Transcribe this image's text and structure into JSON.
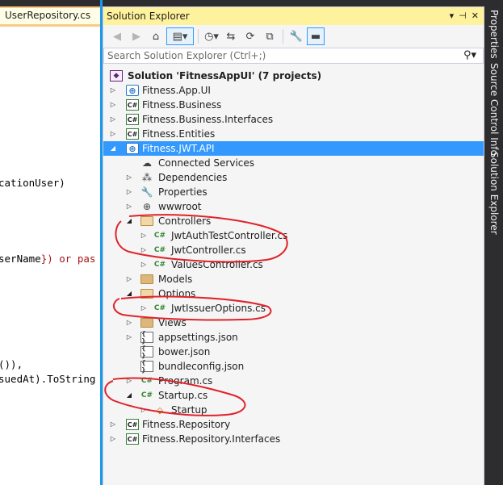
{
  "editor": {
    "tab_label": "UserRepository.cs",
    "code_lines": [
      {
        "pre": "cationUser)",
        "kw": "",
        "post": ""
      },
      {
        "pre": "serName",
        "kw": "",
        "post": "}) or pas"
      },
      {
        "pre": "()),",
        "kw": "",
        "post": ""
      },
      {
        "pre": "suedAt).ToString",
        "kw": "",
        "post": ""
      }
    ]
  },
  "panel": {
    "title": "Solution Explorer",
    "title_buttons": [
      "▾",
      "⊣",
      "✕"
    ],
    "search_placeholder": "Search Solution Explorer (Ctrl+;)",
    "search_glyph": "⚲▾"
  },
  "tree": {
    "solution": "Solution 'FitnessAppUI' (7 projects)",
    "items": [
      {
        "label": "Fitness.App.UI",
        "icon": "web-project-icon"
      },
      {
        "label": "Fitness.Business",
        "icon": "csharp-project-icon"
      },
      {
        "label": "Fitness.Business.Interfaces",
        "icon": "csharp-project-icon"
      },
      {
        "label": "Fitness.Entities",
        "icon": "csharp-project-icon"
      },
      {
        "label": "Fitness.JWT.API",
        "icon": "web-project-icon"
      },
      {
        "label": "Connected Services",
        "icon": "connected-services-icon"
      },
      {
        "label": "Dependencies",
        "icon": "dependencies-icon"
      },
      {
        "label": "Properties",
        "icon": "wrench-icon"
      },
      {
        "label": "wwwroot",
        "icon": "globe-icon"
      },
      {
        "label": "Controllers",
        "icon": "folder-open-icon"
      },
      {
        "label": "JwtAuthTestController.cs",
        "icon": "csharp-file-icon"
      },
      {
        "label": "JwtController.cs",
        "icon": "csharp-file-icon"
      },
      {
        "label": "ValuesController.cs",
        "icon": "csharp-file-icon"
      },
      {
        "label": "Models",
        "icon": "folder-icon"
      },
      {
        "label": "Options",
        "icon": "folder-open-icon"
      },
      {
        "label": "JwtIssuerOptions.cs",
        "icon": "csharp-file-icon"
      },
      {
        "label": "Views",
        "icon": "folder-icon"
      },
      {
        "label": "appsettings.json",
        "icon": "json-file-icon"
      },
      {
        "label": "bower.json",
        "icon": "json-file-icon"
      },
      {
        "label": "bundleconfig.json",
        "icon": "json-file-icon"
      },
      {
        "label": "Program.cs",
        "icon": "csharp-file-icon"
      },
      {
        "label": "Startup.cs",
        "icon": "csharp-file-icon"
      },
      {
        "label": "Startup",
        "icon": "class-icon"
      },
      {
        "label": "Fitness.Repository",
        "icon": "csharp-project-icon"
      },
      {
        "label": "Fitness.Repository.Interfaces",
        "icon": "csharp-project-icon"
      }
    ]
  },
  "vertical_tabs": [
    "Properties",
    "Source Control Info",
    "Solution Explorer"
  ],
  "colors": {
    "selection": "#3399ff",
    "title_bar": "#fff29d",
    "annotation": "#e0222a",
    "csharp_green": "#368832"
  }
}
